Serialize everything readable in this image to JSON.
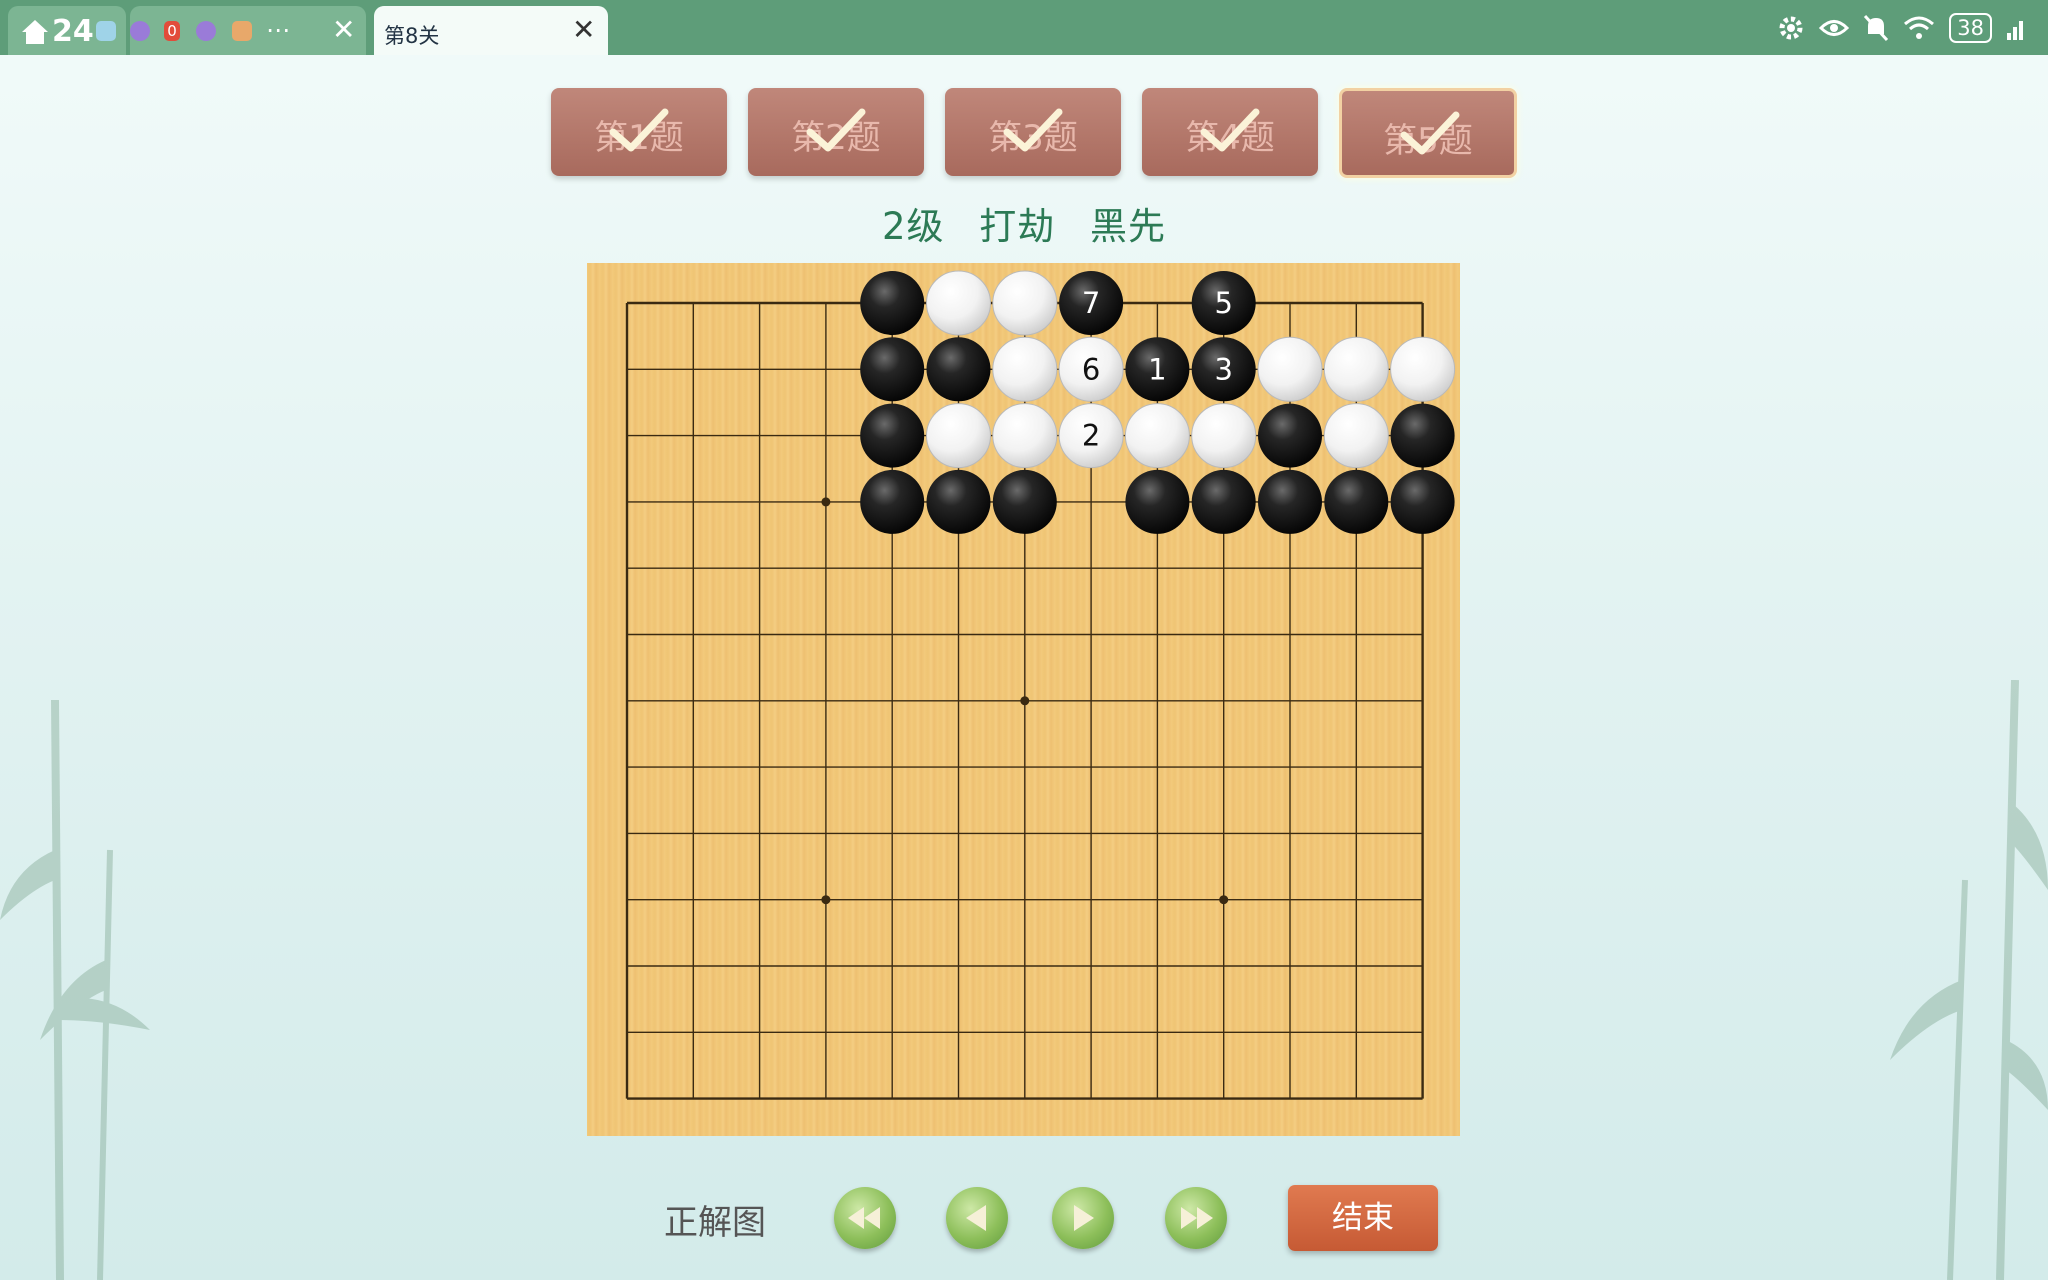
{
  "tabs": {
    "home_counter": "24",
    "group_badge": "0",
    "group_more": "⋯",
    "active_title": "第8关",
    "close_glyph": "✕"
  },
  "status": {
    "battery": "38"
  },
  "questions": [
    {
      "label": "第1题",
      "done": true
    },
    {
      "label": "第2题",
      "done": true
    },
    {
      "label": "第3题",
      "done": true
    },
    {
      "label": "第4题",
      "done": true
    },
    {
      "label": "第5题",
      "done": true,
      "current": true
    }
  ],
  "subtitle": "2级 打劫 黑先",
  "board": {
    "size": 13,
    "stones": [
      {
        "col": 4,
        "row": 0,
        "color": "black"
      },
      {
        "col": 5,
        "row": 0,
        "color": "white"
      },
      {
        "col": 6,
        "row": 0,
        "color": "white"
      },
      {
        "col": 7,
        "row": 0,
        "color": "black",
        "label": "7"
      },
      {
        "col": 9,
        "row": 0,
        "color": "black",
        "label": "5"
      },
      {
        "col": 4,
        "row": 1,
        "color": "black"
      },
      {
        "col": 5,
        "row": 1,
        "color": "black"
      },
      {
        "col": 6,
        "row": 1,
        "color": "white"
      },
      {
        "col": 7,
        "row": 1,
        "color": "white",
        "label": "6"
      },
      {
        "col": 8,
        "row": 1,
        "color": "black",
        "label": "1"
      },
      {
        "col": 9,
        "row": 1,
        "color": "black",
        "label": "3"
      },
      {
        "col": 10,
        "row": 1,
        "color": "white"
      },
      {
        "col": 11,
        "row": 1,
        "color": "white"
      },
      {
        "col": 12,
        "row": 1,
        "color": "white"
      },
      {
        "col": 4,
        "row": 2,
        "color": "black"
      },
      {
        "col": 5,
        "row": 2,
        "color": "white"
      },
      {
        "col": 6,
        "row": 2,
        "color": "white"
      },
      {
        "col": 7,
        "row": 2,
        "color": "white",
        "label": "2"
      },
      {
        "col": 8,
        "row": 2,
        "color": "white"
      },
      {
        "col": 9,
        "row": 2,
        "color": "white"
      },
      {
        "col": 10,
        "row": 2,
        "color": "black"
      },
      {
        "col": 11,
        "row": 2,
        "color": "white"
      },
      {
        "col": 12,
        "row": 2,
        "color": "black"
      },
      {
        "col": 4,
        "row": 3,
        "color": "black"
      },
      {
        "col": 5,
        "row": 3,
        "color": "black"
      },
      {
        "col": 6,
        "row": 3,
        "color": "black"
      },
      {
        "col": 8,
        "row": 3,
        "color": "black"
      },
      {
        "col": 9,
        "row": 3,
        "color": "black"
      },
      {
        "col": 10,
        "row": 3,
        "color": "black"
      },
      {
        "col": 11,
        "row": 3,
        "color": "black"
      },
      {
        "col": 12,
        "row": 3,
        "color": "black"
      }
    ],
    "star_points": [
      [
        3,
        3
      ],
      [
        6,
        6
      ],
      [
        3,
        9
      ],
      [
        9,
        9
      ]
    ]
  },
  "controls": {
    "answer_label": "正解图",
    "first_icon": "rewind-icon",
    "prev_icon": "play-left-icon",
    "next_icon": "play-right-icon",
    "last_icon": "fast-forward-icon",
    "end_label": "结束"
  },
  "colors": {
    "topbar": "#5e9d79",
    "button_brown": "#a86a5d",
    "subtitle_green": "#2c7a55",
    "end_orange": "#c65a34"
  }
}
